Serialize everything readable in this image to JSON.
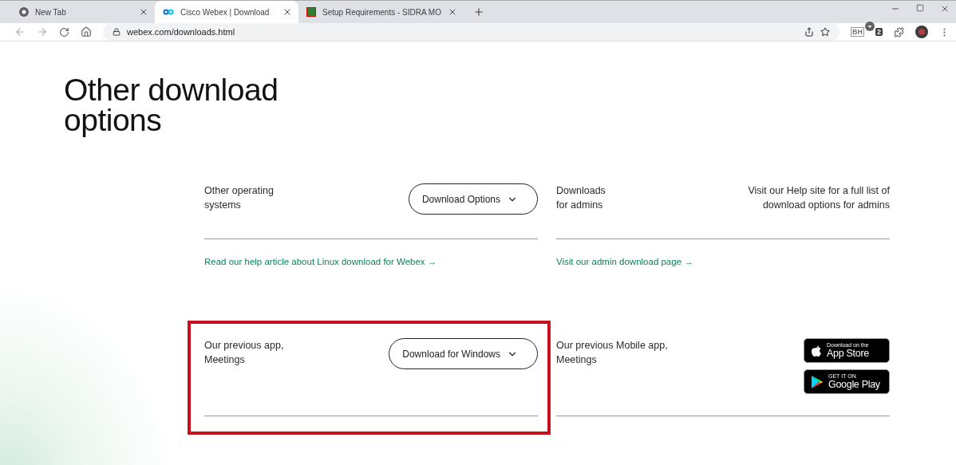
{
  "browser": {
    "tabs": [
      {
        "title": "New Tab",
        "selected": false
      },
      {
        "title": "Cisco Webex | Download",
        "selected": true
      },
      {
        "title": "Setup Requirements - SIDRA MO",
        "selected": false
      }
    ],
    "url": "webex.com/downloads.html",
    "extensions": [
      {
        "text": "BH",
        "kind": "plain"
      },
      {
        "text": "2",
        "kind": "badge"
      }
    ]
  },
  "page": {
    "heading": "Other download options",
    "rows": [
      {
        "cells": [
          {
            "label": [
              "Other operating",
              "systems"
            ],
            "button": "Download Options",
            "link": "Read our help article about Linux download for Webex →"
          },
          {
            "label": [
              "Downloads",
              "for admins"
            ],
            "note": "Visit our Help site for a full list of download options for admins",
            "link": "Visit our admin download page →"
          }
        ]
      },
      {
        "cells": [
          {
            "label": [
              "Our previous app,",
              "Meetings"
            ],
            "button": "Download for Windows",
            "highlighted": true
          },
          {
            "label": [
              "Our previous Mobile app,",
              "Meetings"
            ],
            "badges": [
              {
                "kind": "apple",
                "small": "Download on the",
                "big": "App Store"
              },
              {
                "kind": "google",
                "small": "GET IT ON",
                "big": "Google Play"
              }
            ]
          }
        ]
      }
    ]
  }
}
